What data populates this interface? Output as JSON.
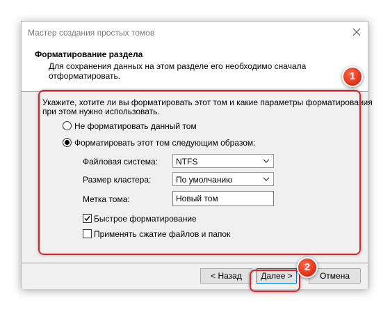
{
  "window": {
    "title": "Мастер создания простых томов"
  },
  "header": {
    "title": "Форматирование раздела",
    "description_line1": "Для сохранения данных на этом разделе его необходимо сначала",
    "description_line2": "отформатировать."
  },
  "body": {
    "instruction_line1": "Укажите, хотите ли вы форматировать этот том и какие параметры форматирования",
    "instruction_line2": "при этом нужно использовать.",
    "options": [
      {
        "label": "Не форматировать данный том",
        "selected": false
      },
      {
        "label": "Форматировать этот том следующим образом:",
        "selected": true
      }
    ],
    "fields": {
      "filesystem": {
        "label": "Файловая система:",
        "value": "NTFS"
      },
      "cluster": {
        "label": "Размер кластера:",
        "value": "По умолчанию"
      },
      "volume_label": {
        "label": "Метка тома:",
        "value": "Новый том"
      }
    },
    "checkboxes": [
      {
        "label": "Быстрое форматирование",
        "checked": true
      },
      {
        "label": "Применять сжатие файлов и папок",
        "checked": false
      }
    ]
  },
  "footer": {
    "back_label": "< Назад",
    "next_label": "Далее >",
    "cancel_label": "Отмена"
  },
  "annotations": {
    "badge1": "1",
    "badge2": "2"
  },
  "colors": {
    "highlight": "#d9232a",
    "accent": "#0078d7"
  }
}
